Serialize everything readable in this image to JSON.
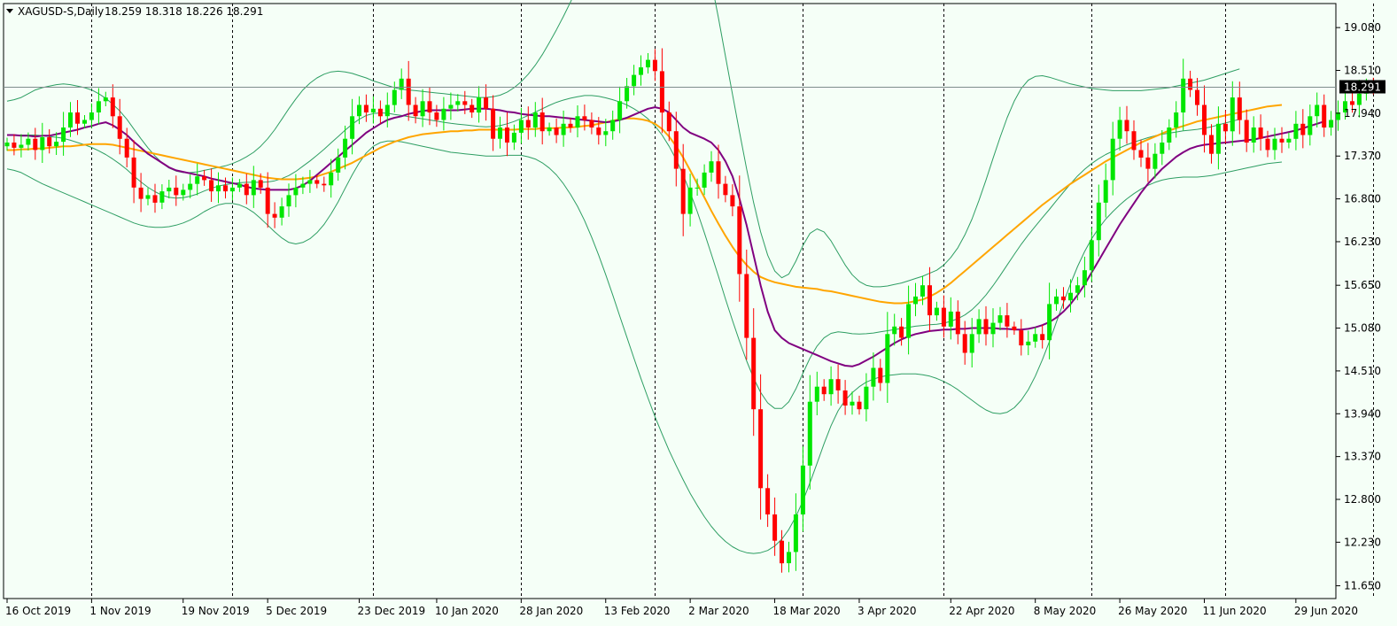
{
  "header": {
    "symbol": "XAGUSD-S,Daily",
    "ohlc": "18.259 18.318 18.226 18.291"
  },
  "colors": {
    "background": "#f5fff7",
    "bull_candle": "#00e600",
    "bear_candle": "#ff0000",
    "bollinger": "#2e9e63",
    "ma_fast": "#800080",
    "ma_slow": "#ffa500",
    "price_line": "#7f8c8d",
    "current_price_bg": "#000000"
  },
  "chart_data": {
    "type": "candlestick",
    "symbol": "XAGUSD-S",
    "timeframe": "Daily",
    "current_price": "18.291",
    "y_range": [
      11.48,
      19.4
    ],
    "y_ticks": [
      "19.080",
      "18.510",
      "17.940",
      "17.370",
      "16.800",
      "16.230",
      "15.650",
      "15.080",
      "14.510",
      "13.940",
      "13.370",
      "12.800",
      "12.230",
      "11.650"
    ],
    "x_labels": [
      {
        "label": "16 Oct 2019",
        "bar": 0
      },
      {
        "label": "1 Nov 2019",
        "bar": 12
      },
      {
        "label": "19 Nov 2019",
        "bar": 25
      },
      {
        "label": "5 Dec 2019",
        "bar": 37
      },
      {
        "label": "23 Dec 2019",
        "bar": 50
      },
      {
        "label": "10 Jan 2020",
        "bar": 61
      },
      {
        "label": "28 Jan 2020",
        "bar": 73
      },
      {
        "label": "13 Feb 2020",
        "bar": 85
      },
      {
        "label": "2 Mar 2020",
        "bar": 97
      },
      {
        "label": "18 Mar 2020",
        "bar": 109
      },
      {
        "label": "3 Apr 2020",
        "bar": 121
      },
      {
        "label": "22 Apr 2020",
        "bar": 134
      },
      {
        "label": "8 May 2020",
        "bar": 146
      },
      {
        "label": "26 May 2020",
        "bar": 158
      },
      {
        "label": "11 Jun 2020",
        "bar": 170
      },
      {
        "label": "29 Jun 2020",
        "bar": 183
      }
    ],
    "separators": [
      12,
      32,
      52,
      73,
      92,
      113,
      133,
      154,
      173,
      194
    ],
    "closes": [
      17.55,
      17.48,
      17.52,
      17.6,
      17.45,
      17.62,
      17.5,
      17.56,
      17.75,
      17.95,
      17.8,
      17.85,
      17.95,
      18.1,
      18.15,
      17.9,
      17.6,
      17.35,
      16.95,
      16.8,
      16.85,
      16.75,
      16.9,
      16.95,
      16.85,
      16.92,
      17.0,
      17.1,
      17.05,
      16.9,
      16.98,
      16.9,
      16.95,
      17.0,
      16.85,
      17.05,
      16.95,
      16.6,
      16.55,
      16.7,
      16.85,
      16.95,
      17.0,
      17.05,
      17.0,
      16.98,
      17.15,
      17.35,
      17.6,
      17.9,
      18.05,
      17.95,
      18.0,
      17.9,
      18.05,
      18.25,
      18.4,
      18.05,
      17.9,
      18.1,
      17.95,
      17.85,
      18.0,
      18.05,
      18.1,
      18.05,
      17.95,
      18.15,
      18.0,
      17.6,
      17.75,
      17.55,
      17.68,
      17.85,
      17.75,
      17.95,
      17.7,
      17.75,
      17.65,
      17.8,
      17.75,
      17.9,
      17.85,
      17.75,
      17.65,
      17.7,
      17.85,
      18.1,
      18.3,
      18.45,
      18.55,
      18.65,
      18.5,
      17.95,
      17.7,
      17.2,
      16.6,
      16.95,
      16.95,
      17.15,
      17.3,
      17.0,
      16.85,
      16.7,
      15.8,
      14.95,
      14.0,
      12.95,
      12.6,
      12.25,
      11.95,
      12.1,
      12.6,
      13.25,
      14.1,
      14.3,
      14.2,
      14.4,
      14.25,
      14.05,
      14.1,
      14.0,
      14.3,
      14.55,
      14.35,
      15.0,
      15.1,
      14.95,
      15.4,
      15.5,
      15.65,
      15.25,
      15.35,
      15.1,
      15.3,
      15.0,
      14.75,
      15.0,
      15.2,
      15.0,
      15.15,
      15.25,
      15.1,
      15.05,
      14.85,
      14.9,
      15.0,
      14.92,
      15.4,
      15.5,
      15.45,
      15.55,
      15.65,
      15.85,
      16.25,
      16.75,
      17.05,
      17.6,
      17.85,
      17.7,
      17.45,
      17.35,
      17.2,
      17.4,
      17.55,
      17.75,
      17.95,
      18.4,
      18.25,
      18.05,
      17.65,
      17.4,
      17.8,
      17.7,
      18.15,
      17.85,
      17.55,
      17.75,
      17.6,
      17.45,
      17.6,
      17.55,
      17.6,
      17.8,
      17.65,
      17.9,
      18.05,
      17.75,
      17.85,
      17.95,
      18.1,
      18.05,
      18.2,
      18.3,
      18.291
    ],
    "ma_fast": [
      17.65,
      17.65,
      17.64,
      17.64,
      17.63,
      17.64,
      17.64,
      17.66,
      17.68,
      17.7,
      17.72,
      17.75,
      17.77,
      17.8,
      17.82,
      17.78,
      17.72,
      17.65,
      17.56,
      17.48,
      17.4,
      17.34,
      17.28,
      17.22,
      17.18,
      17.16,
      17.14,
      17.12,
      17.1,
      17.07,
      17.05,
      17.03,
      17.01,
      16.99,
      16.96,
      16.94,
      16.93,
      16.92,
      16.92,
      16.92,
      16.92,
      16.94,
      16.98,
      17.04,
      17.12,
      17.2,
      17.28,
      17.36,
      17.44,
      17.52,
      17.6,
      17.68,
      17.74,
      17.8,
      17.85,
      17.88,
      17.9,
      17.93,
      17.95,
      17.97,
      17.98,
      17.98,
      17.98,
      17.98,
      17.98,
      17.99,
      18.0,
      18.0,
      18.0,
      17.99,
      17.98,
      17.96,
      17.95,
      17.93,
      17.92,
      17.91,
      17.9,
      17.9,
      17.89,
      17.88,
      17.87,
      17.86,
      17.85,
      17.84,
      17.83,
      17.82,
      17.83,
      17.85,
      17.88,
      17.92,
      17.96,
      18.0,
      18.02,
      18.0,
      17.95,
      17.85,
      17.75,
      17.68,
      17.64,
      17.6,
      17.55,
      17.45,
      17.3,
      17.1,
      16.8,
      16.45,
      16.05,
      15.65,
      15.3,
      15.05,
      14.95,
      14.88,
      14.84,
      14.8,
      14.76,
      14.72,
      14.68,
      14.64,
      14.61,
      14.58,
      14.57,
      14.6,
      14.65,
      14.7,
      14.76,
      14.82,
      14.88,
      14.93,
      14.97,
      15.0,
      15.02,
      15.04,
      15.05,
      15.06,
      15.06,
      15.07,
      15.07,
      15.08,
      15.08,
      15.08,
      15.08,
      15.07,
      15.07,
      15.06,
      15.06,
      15.07,
      15.09,
      15.12,
      15.16,
      15.22,
      15.3,
      15.4,
      15.52,
      15.66,
      15.82,
      15.98,
      16.14,
      16.3,
      16.46,
      16.6,
      16.74,
      16.88,
      17.0,
      17.1,
      17.2,
      17.28,
      17.36,
      17.42,
      17.47,
      17.5,
      17.52,
      17.53,
      17.54,
      17.55,
      17.56,
      17.57,
      17.58,
      17.59,
      17.61,
      17.63,
      17.65,
      17.67,
      17.69,
      17.71,
      17.74,
      17.77,
      17.8,
      17.83
    ],
    "ma_slow": [
      17.45,
      17.45,
      17.46,
      17.46,
      17.47,
      17.47,
      17.48,
      17.49,
      17.5,
      17.5,
      17.51,
      17.52,
      17.53,
      17.53,
      17.53,
      17.52,
      17.5,
      17.48,
      17.46,
      17.44,
      17.42,
      17.4,
      17.38,
      17.36,
      17.34,
      17.32,
      17.3,
      17.28,
      17.26,
      17.24,
      17.22,
      17.2,
      17.18,
      17.16,
      17.14,
      17.12,
      17.1,
      17.08,
      17.07,
      17.06,
      17.06,
      17.06,
      17.07,
      17.08,
      17.1,
      17.13,
      17.16,
      17.2,
      17.24,
      17.28,
      17.33,
      17.38,
      17.43,
      17.48,
      17.52,
      17.56,
      17.59,
      17.62,
      17.64,
      17.66,
      17.67,
      17.68,
      17.69,
      17.7,
      17.7,
      17.71,
      17.71,
      17.72,
      17.72,
      17.72,
      17.72,
      17.72,
      17.72,
      17.73,
      17.73,
      17.73,
      17.74,
      17.74,
      17.74,
      17.75,
      17.75,
      17.76,
      17.77,
      17.78,
      17.8,
      17.82,
      17.84,
      17.86,
      17.87,
      17.87,
      17.86,
      17.84,
      17.8,
      17.73,
      17.63,
      17.5,
      17.35,
      17.18,
      17.0,
      16.82,
      16.64,
      16.47,
      16.31,
      16.16,
      16.03,
      15.92,
      15.83,
      15.76,
      15.72,
      15.69,
      15.67,
      15.65,
      15.63,
      15.62,
      15.61,
      15.6,
      15.58,
      15.57,
      15.55,
      15.53,
      15.51,
      15.49,
      15.47,
      15.45,
      15.43,
      15.42,
      15.41,
      15.41,
      15.42,
      15.44,
      15.46,
      15.5,
      15.55,
      15.61,
      15.68,
      15.76,
      15.84,
      15.92,
      16.0,
      16.08,
      16.16,
      16.24,
      16.32,
      16.4,
      16.48,
      16.56,
      16.64,
      16.72,
      16.79,
      16.86,
      16.93,
      17.0,
      17.06,
      17.12,
      17.18,
      17.24,
      17.3,
      17.35,
      17.4,
      17.45,
      17.5,
      17.55,
      17.59,
      17.63,
      17.67,
      17.71,
      17.74,
      17.77,
      17.8,
      17.83,
      17.85,
      17.87,
      17.89,
      17.91,
      17.93,
      17.95,
      17.97,
      17.99,
      18.01,
      18.03,
      18.04,
      18.05
    ],
    "bb_upper": [
      18.1,
      18.12,
      18.15,
      18.2,
      18.25,
      18.28,
      18.3,
      18.32,
      18.33,
      18.32,
      18.3,
      18.28,
      18.25,
      18.2,
      18.14,
      18.06,
      17.97,
      17.86,
      17.73,
      17.6,
      17.48,
      17.37,
      17.28,
      17.21,
      17.17,
      17.15,
      17.15,
      17.16,
      17.18,
      17.2,
      17.22,
      17.24,
      17.27,
      17.31,
      17.36,
      17.42,
      17.5,
      17.6,
      17.72,
      17.86,
      18.0,
      18.13,
      18.25,
      18.34,
      18.41,
      18.46,
      18.49,
      18.5,
      18.49,
      18.47,
      18.44,
      18.41,
      18.37,
      18.34,
      18.31,
      18.28,
      18.26,
      18.25,
      18.24,
      18.23,
      18.22,
      18.21,
      18.2,
      18.19,
      18.18,
      18.17,
      18.16,
      18.15,
      18.15,
      18.16,
      18.18,
      18.22,
      18.28,
      18.36,
      18.46,
      18.58,
      18.72,
      18.88,
      19.05,
      19.23,
      19.42,
      19.62,
      19.84,
      20.06,
      20.28,
      20.5,
      20.72,
      20.94,
      21.14,
      21.32,
      21.47,
      21.58,
      21.64,
      21.63,
      21.55,
      21.4,
      21.18,
      20.89,
      20.54,
      20.13,
      19.69,
      19.21,
      18.7,
      18.19,
      17.69,
      17.2,
      16.75,
      16.36,
      16.05,
      15.84,
      15.75,
      15.8,
      15.97,
      16.18,
      16.34,
      16.4,
      16.36,
      16.24,
      16.08,
      15.92,
      15.79,
      15.7,
      15.65,
      15.63,
      15.63,
      15.64,
      15.66,
      15.68,
      15.71,
      15.74,
      15.77,
      15.81,
      15.85,
      15.92,
      16.02,
      16.15,
      16.32,
      16.53,
      16.78,
      17.05,
      17.34,
      17.62,
      17.88,
      18.1,
      18.27,
      18.38,
      18.43,
      18.44,
      18.42,
      18.39,
      18.36,
      18.33,
      18.31,
      18.29,
      18.27,
      18.26,
      18.25,
      18.24,
      18.24,
      18.24,
      18.24,
      18.24,
      18.25,
      18.26,
      18.27,
      18.28,
      18.3,
      18.32,
      18.34,
      18.36,
      18.38,
      18.41,
      18.44,
      18.47,
      18.5,
      18.53
    ],
    "bb_lower": [
      17.2,
      17.18,
      17.15,
      17.1,
      17.05,
      17.0,
      16.96,
      16.92,
      16.88,
      16.84,
      16.8,
      16.76,
      16.72,
      16.68,
      16.64,
      16.6,
      16.56,
      16.52,
      16.48,
      16.45,
      16.43,
      16.42,
      16.42,
      16.43,
      16.45,
      16.48,
      16.52,
      16.57,
      16.63,
      16.68,
      16.72,
      16.74,
      16.74,
      16.72,
      16.68,
      16.62,
      16.54,
      16.45,
      16.36,
      16.28,
      16.22,
      16.2,
      16.22,
      16.27,
      16.35,
      16.46,
      16.6,
      16.76,
      16.94,
      17.12,
      17.28,
      17.41,
      17.5,
      17.55,
      17.57,
      17.57,
      17.56,
      17.54,
      17.52,
      17.5,
      17.48,
      17.46,
      17.44,
      17.42,
      17.41,
      17.4,
      17.39,
      17.38,
      17.37,
      17.37,
      17.37,
      17.38,
      17.38,
      17.38,
      17.36,
      17.33,
      17.28,
      17.21,
      17.12,
      17.0,
      16.86,
      16.7,
      16.51,
      16.29,
      16.05,
      15.79,
      15.52,
      15.24,
      14.96,
      14.68,
      14.41,
      14.15,
      13.9,
      13.67,
      13.45,
      13.25,
      13.06,
      12.88,
      12.72,
      12.57,
      12.44,
      12.33,
      12.24,
      12.17,
      12.12,
      12.09,
      12.08,
      12.09,
      12.12,
      12.18,
      12.27,
      12.4,
      12.57,
      12.78,
      13.02,
      13.28,
      13.54,
      13.78,
      13.98,
      14.12,
      14.22,
      14.3,
      14.36,
      14.4,
      14.43,
      14.45,
      14.46,
      14.47,
      14.47,
      14.47,
      14.46,
      14.44,
      14.41,
      14.37,
      14.32,
      14.26,
      14.19,
      14.12,
      14.05,
      13.99,
      13.95,
      13.94,
      13.96,
      14.02,
      14.12,
      14.26,
      14.44,
      14.66,
      14.9,
      15.16,
      15.42,
      15.67,
      15.9,
      16.1,
      16.27,
      16.41,
      16.53,
      16.63,
      16.72,
      16.8,
      16.87,
      16.93,
      16.98,
      17.02,
      17.05,
      17.07,
      17.08,
      17.09,
      17.09,
      17.09,
      17.1,
      17.11,
      17.13,
      17.15,
      17.17,
      17.19,
      17.21,
      17.23,
      17.25,
      17.27,
      17.28,
      17.29
    ]
  }
}
